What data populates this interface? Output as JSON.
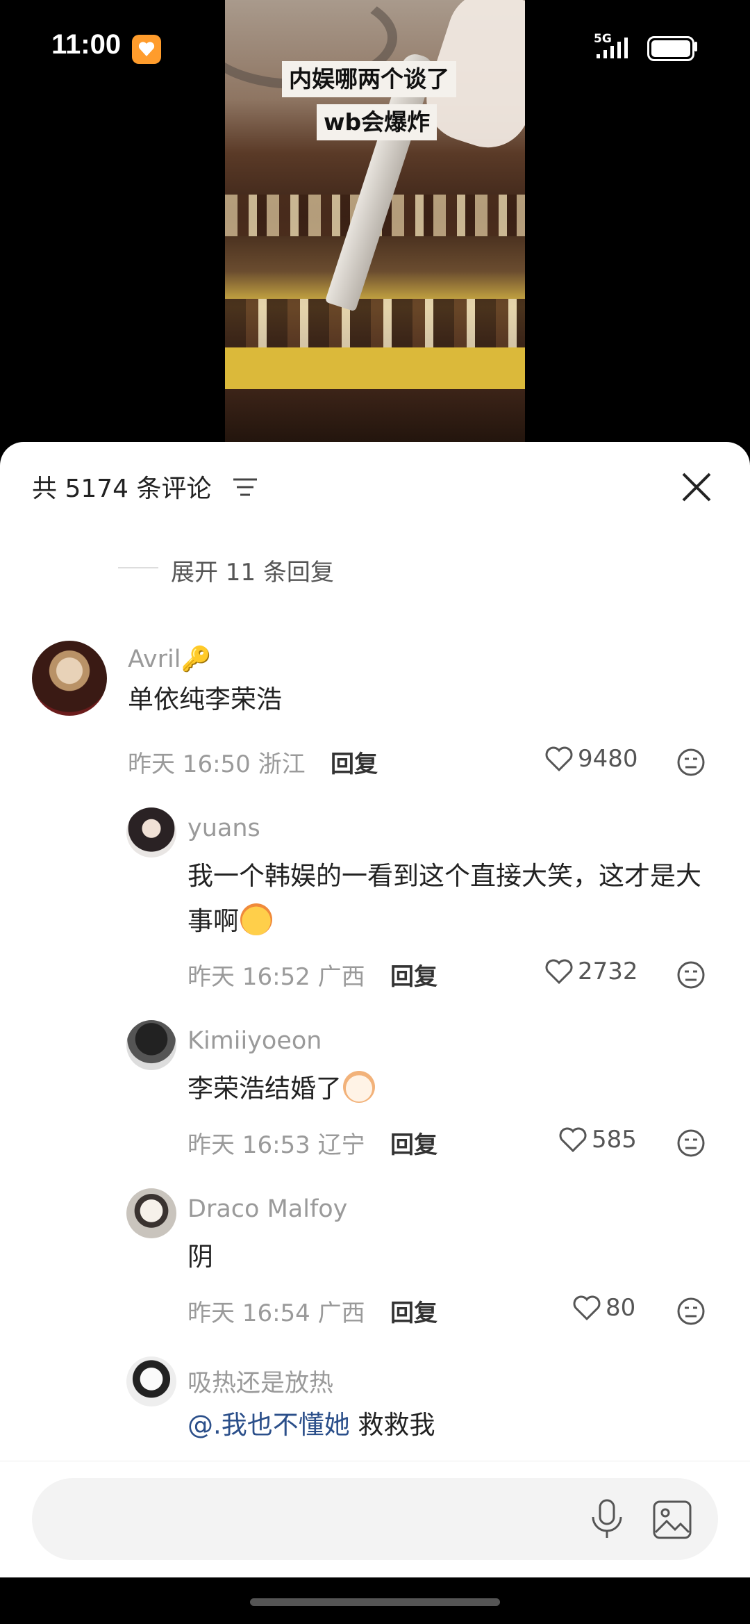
{
  "status_bar": {
    "time": "11:00",
    "network": "5G"
  },
  "video": {
    "caption_line1": "内娱哪两个谈了",
    "caption_line2": "wb会爆炸"
  },
  "comments_header": {
    "title": "共 5174 条评论"
  },
  "expand_replies": {
    "label": "展开 11 条回复"
  },
  "comments": [
    {
      "username": "Avril🔑",
      "text": "单依纯李荣浩",
      "time_location": "昨天 16:50 浙江",
      "reply_label": "回复",
      "likes": "9480"
    },
    {
      "username": "yuans",
      "text": "我一个韩娱的一看到这个直接大笑，这才是大事啊",
      "time_location": "昨天 16:52 广西",
      "reply_label": "回复",
      "likes": "2732"
    },
    {
      "username": "Kimiiyoeon",
      "text": "李荣浩结婚了",
      "time_location": "昨天 16:53 辽宁",
      "reply_label": "回复",
      "likes": "585"
    },
    {
      "username": "Draco Malfoy",
      "text": "阴",
      "time_location": "昨天 16:54 广西",
      "reply_label": "回复",
      "likes": "80"
    },
    {
      "username": "吸热还是放热",
      "mention": "@.我也不懂她",
      "text": " 救救我"
    }
  ],
  "input_bar": {
    "placeholder": ""
  },
  "colors": {
    "accent_orange": "#ff9c2c",
    "mention_blue": "#2b4f8a"
  }
}
